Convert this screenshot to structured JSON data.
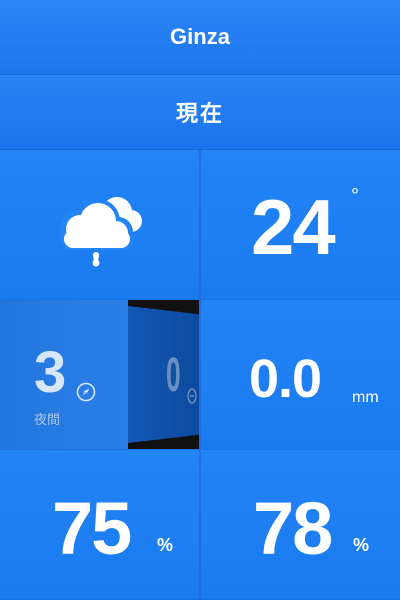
{
  "header": {
    "location": "Ginza",
    "period": "現在"
  },
  "weather": {
    "icon": "rain-cloud-icon",
    "temperature": "24",
    "temperature_unit": "°"
  },
  "wind": {
    "value": "3",
    "label": "夜間",
    "icon": "compass-icon",
    "next_value": "0"
  },
  "rainfall": {
    "value": "0.0",
    "unit": "mm"
  },
  "humidity": [
    {
      "value": "75",
      "unit": "%"
    },
    {
      "value": "78",
      "unit": "%"
    }
  ],
  "colors": {
    "background": "#1a72e8",
    "tile": "#2384f6",
    "text": "#ffffff"
  }
}
